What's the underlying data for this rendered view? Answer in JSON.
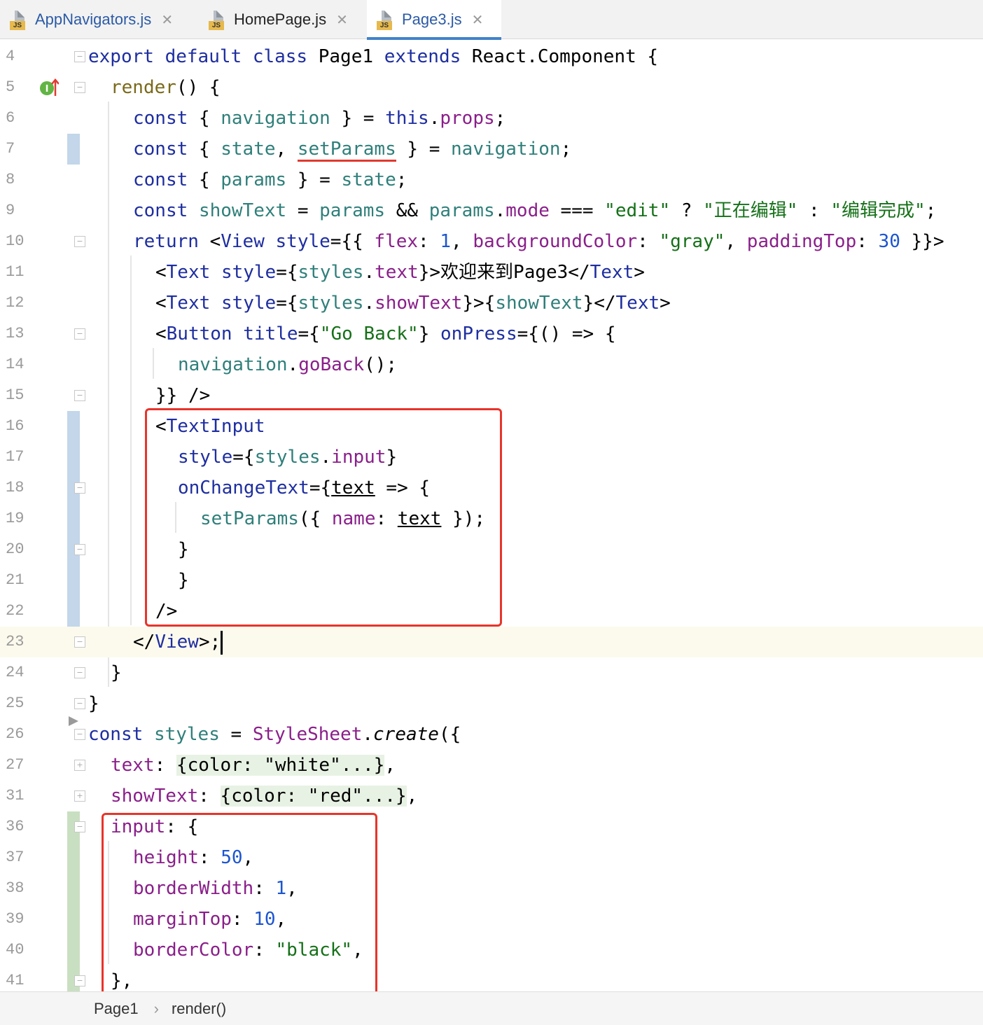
{
  "tabs": [
    {
      "label": "AppNavigators.js",
      "icon": "js-file-icon",
      "close": "✕",
      "badge": "JS"
    },
    {
      "label": "HomePage.js",
      "icon": "js-file-icon",
      "close": "✕",
      "badge": "JS"
    },
    {
      "label": "Page3.js",
      "icon": "js-file-icon",
      "close": "✕",
      "badge": "JS",
      "active": true
    }
  ],
  "line_numbers": [
    "4",
    "5",
    "6",
    "7",
    "8",
    "9",
    "10",
    "11",
    "12",
    "13",
    "14",
    "15",
    "16",
    "17",
    "18",
    "19",
    "20",
    "21",
    "22",
    "23",
    "24",
    "25",
    "26",
    "27",
    "31",
    "36",
    "37",
    "38",
    "39",
    "40",
    "41"
  ],
  "code": {
    "l4": [
      "export",
      "default",
      "class",
      "Page1",
      "extends",
      "React.Component {"
    ],
    "l5": [
      "render",
      "() {"
    ],
    "l6": [
      "const",
      "{ ",
      "navigation",
      " } = ",
      "this",
      ".",
      "props",
      ";"
    ],
    "l7": [
      "const",
      "{ ",
      "state",
      ", ",
      "setParams",
      " } = ",
      "navigation",
      ";"
    ],
    "l8": [
      "const",
      "{ ",
      "params",
      " } = ",
      "state",
      ";"
    ],
    "l9": [
      "const",
      "showText",
      " = ",
      "params",
      " && ",
      "params",
      ".",
      "mode",
      " === ",
      "\"edit\"",
      " ? ",
      "\"正在编辑\"",
      " : ",
      "\"编辑完成\"",
      ";"
    ],
    "l10": [
      "return",
      "<",
      "View",
      " ",
      "style",
      "={{ ",
      "flex",
      ": ",
      "1",
      ", ",
      "backgroundColor",
      ": ",
      "\"gray\"",
      ", ",
      "paddingTop",
      ": ",
      "30",
      " }}>"
    ],
    "l11": [
      "<",
      "Text",
      " ",
      "style",
      "={",
      "styles",
      ".",
      "text",
      "}>欢迎来到Page3</",
      "Text",
      ">"
    ],
    "l12": [
      "<",
      "Text",
      " ",
      "style",
      "={",
      "styles",
      ".",
      "showText",
      "}>{",
      "showText",
      "}</",
      "Text",
      ">"
    ],
    "l13": [
      "<",
      "Button",
      " ",
      "title",
      "={",
      "\"Go Back\"",
      "} ",
      "onPress",
      "={() => {"
    ],
    "l14": [
      "navigation",
      ".",
      "goBack",
      "();"
    ],
    "l15": [
      "}} />"
    ],
    "l16": [
      "<",
      "TextInput"
    ],
    "l17": [
      "style",
      "={",
      "styles",
      ".",
      "input",
      "}"
    ],
    "l18": [
      "onChangeText",
      "={",
      "text",
      " => {"
    ],
    "l19": [
      "setParams",
      "({ ",
      "name",
      ": ",
      "text",
      " });"
    ],
    "l20": [
      "}"
    ],
    "l21": [
      "}"
    ],
    "l22": [
      "/>"
    ],
    "l23": [
      "</",
      "View",
      ">;"
    ],
    "l24": [
      "}"
    ],
    "l25": [
      "}"
    ],
    "l26": [
      "const",
      "styles",
      " = ",
      "StyleSheet",
      ".",
      "create",
      "({"
    ],
    "l27": [
      "text",
      ": ",
      "{color: \"white\"...}",
      ","
    ],
    "l31": [
      "showText",
      ": ",
      "{color: \"red\"...}",
      ","
    ],
    "l36": [
      "input",
      ": {"
    ],
    "l37": [
      "height",
      ": ",
      "50",
      ","
    ],
    "l38": [
      "borderWidth",
      ": ",
      "1",
      ","
    ],
    "l39": [
      "marginTop",
      ": ",
      "10",
      ","
    ],
    "l40": [
      "borderColor",
      ": ",
      "\"black\"",
      ","
    ],
    "l41": [
      "},"
    ]
  },
  "breadcrumb": {
    "items": [
      "Page1",
      "render()"
    ],
    "separator": "›"
  },
  "colors": {
    "keyword": "#1e2ea0",
    "property": "#2f7f7a",
    "member": "#8a1f8a",
    "string": "#157018",
    "number": "#1c55d0",
    "function": "#7a6a1a",
    "highlight_box": "#e8342b",
    "tab_underline": "#4083c9",
    "caret_line": "#fcfaed"
  }
}
